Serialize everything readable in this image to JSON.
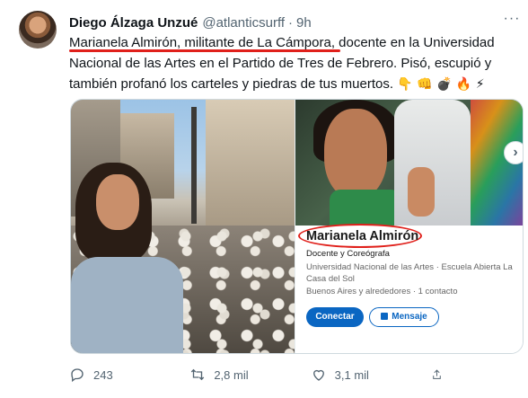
{
  "tweet": {
    "display_name": "Diego Álzaga Unzué",
    "handle": "@atlanticsurff",
    "separator": "·",
    "time": "9h",
    "text_highlight": "Marianela Almirón, militante de La Cámpora",
    "text_rest": ", docente en la Universidad Nacional de las Artes en el Partido de Tres de Febrero. Pisó, escupió y también profanó los carteles y piedras de tus muertos.",
    "emojis": "👇 👊 💣 🔥 ⚡",
    "more_label": "···"
  },
  "linkedin_card": {
    "name": "Marianela Almirón",
    "title": "Docente y Coreógrafa",
    "education": "Universidad Nacional de las Artes · Escuela Abierta La Casa del Sol",
    "location_connections": "Buenos Aires y alrededores · 1 contacto",
    "connect_label": "Conectar",
    "message_label": "Mensaje"
  },
  "actions": {
    "replies": "243",
    "retweets": "2,8 mil",
    "likes": "3,1 mil"
  },
  "colors": {
    "annotation_red": "#e0201b",
    "linkedin_blue": "#0a66c2",
    "muted": "#536471"
  },
  "icons": [
    "more-icon",
    "reply-icon",
    "retweet-icon",
    "like-icon",
    "share-icon",
    "next-arrow-icon",
    "lock-icon"
  ]
}
